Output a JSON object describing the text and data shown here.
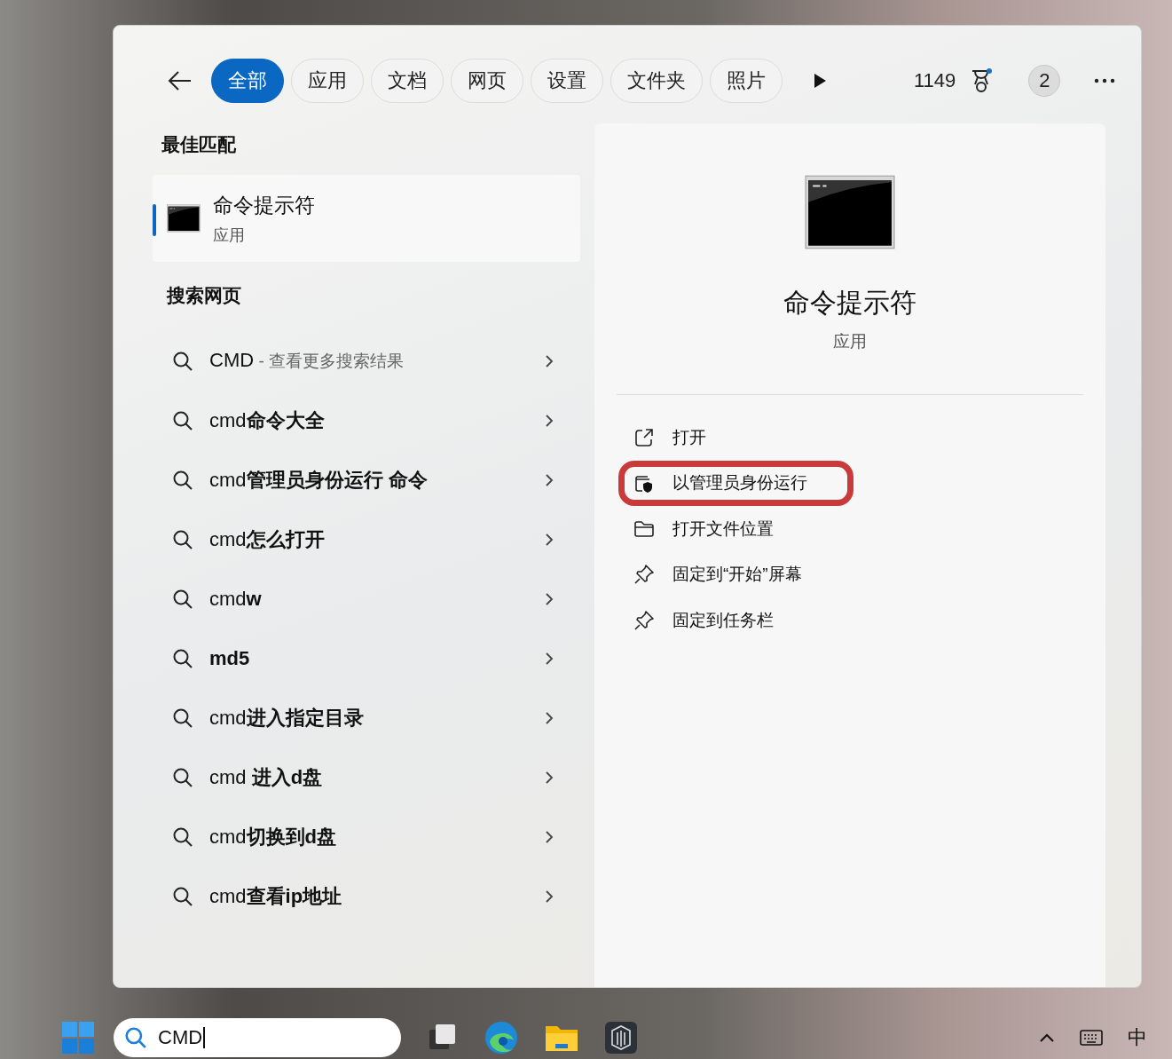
{
  "tabs": [
    {
      "label": "全部",
      "selected": true
    },
    {
      "label": "应用",
      "selected": false
    },
    {
      "label": "文档",
      "selected": false
    },
    {
      "label": "网页",
      "selected": false
    },
    {
      "label": "设置",
      "selected": false
    },
    {
      "label": "文件夹",
      "selected": false
    },
    {
      "label": "照片",
      "selected": false
    }
  ],
  "points": "1149",
  "account_badge": "2",
  "best_match": {
    "heading": "最佳匹配",
    "title": "命令提示符",
    "subtitle": "应用",
    "selected": true
  },
  "web_search": {
    "heading": "搜索网页",
    "items": [
      {
        "text": "CMD",
        "hint": "- 查看更多搜索结果"
      },
      {
        "text": "cmd**命令大全**"
      },
      {
        "text": "cmd**管理员身份运行 命令**"
      },
      {
        "text": "cmd**怎么打开**"
      },
      {
        "text": "cmd**w**"
      },
      {
        "text": "**md5**"
      },
      {
        "text": "cmd**进入指定目录**"
      },
      {
        "text": "cmd **进入d盘**"
      },
      {
        "text": "cmd**切换到d盘**"
      },
      {
        "text": "cmd**查看ip地址**"
      }
    ]
  },
  "detail": {
    "title": "命令提示符",
    "subtitle": "应用",
    "actions": [
      {
        "kind": "open",
        "label": "打开",
        "highlighted": false
      },
      {
        "kind": "admin",
        "label": "以管理员身份运行",
        "highlighted": true
      },
      {
        "kind": "folder",
        "label": "打开文件位置",
        "highlighted": false
      },
      {
        "kind": "pin",
        "label": "固定到“开始”屏幕",
        "highlighted": false
      },
      {
        "kind": "pin",
        "label": "固定到任务栏",
        "highlighted": false
      }
    ]
  },
  "taskbar": {
    "search_value": "CMD",
    "input_indicator": "中"
  }
}
